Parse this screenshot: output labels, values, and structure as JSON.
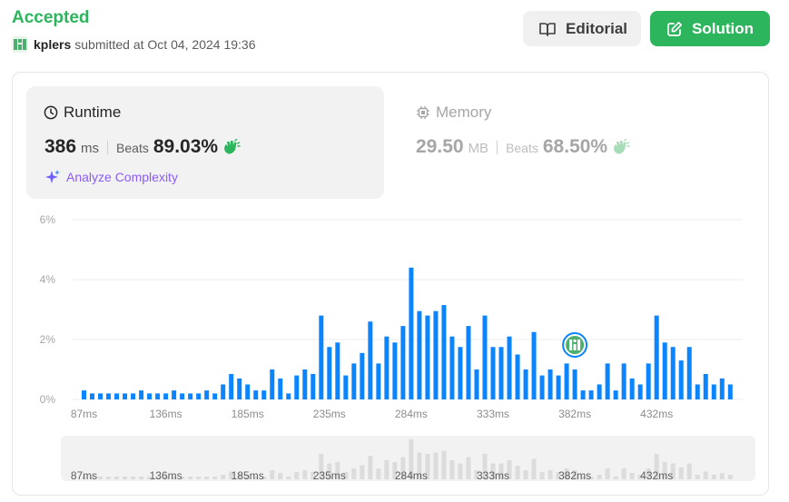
{
  "header": {
    "status": "Accepted",
    "username": "kplers",
    "submitted_text": "submitted at Oct 04, 2024 19:36",
    "editorial_label": "Editorial",
    "solution_label": "Solution"
  },
  "runtime": {
    "title": "Runtime",
    "value": "386",
    "unit": "ms",
    "beats_label": "Beats",
    "beats_pct": "89.03%",
    "analyze_label": "Analyze Complexity"
  },
  "memory": {
    "title": "Memory",
    "value": "29.50",
    "unit": "MB",
    "beats_label": "Beats",
    "beats_pct": "68.50%"
  },
  "colors": {
    "accent_green": "#2db55d",
    "bar_blue": "#0a84ff",
    "nav_bar_gray": "#dcdcdc",
    "analyze_purple": "#8b5cf6"
  },
  "chart_data": {
    "type": "bar",
    "title": "",
    "xlabel": "",
    "ylabel": "",
    "ylim": [
      0,
      6
    ],
    "y_ticks": [
      "0%",
      "2%",
      "4%",
      "6%"
    ],
    "x_tick_labels": [
      "87ms",
      "136ms",
      "185ms",
      "235ms",
      "284ms",
      "333ms",
      "382ms",
      "432ms"
    ],
    "x_tick_bar_index": [
      0,
      10,
      20,
      30,
      40,
      50,
      60,
      70
    ],
    "values": [
      0.3,
      0.2,
      0.2,
      0.2,
      0.2,
      0.2,
      0.2,
      0.3,
      0.2,
      0.2,
      0.2,
      0.3,
      0.2,
      0.2,
      0.2,
      0.3,
      0.2,
      0.5,
      0.85,
      0.7,
      0.5,
      0.3,
      0.3,
      1.0,
      0.7,
      0.2,
      0.8,
      1.0,
      0.85,
      2.8,
      1.75,
      1.9,
      0.8,
      1.2,
      1.55,
      2.6,
      1.2,
      2.1,
      1.9,
      2.45,
      4.4,
      2.95,
      2.8,
      2.95,
      3.15,
      2.1,
      1.75,
      2.45,
      1.0,
      2.8,
      1.75,
      1.75,
      2.1,
      1.5,
      1.0,
      2.25,
      0.8,
      1.0,
      0.8,
      1.2,
      1.0,
      0.3,
      0.3,
      0.5,
      1.2,
      0.3,
      1.2,
      0.7,
      0.5,
      1.2,
      2.8,
      1.9,
      1.75,
      1.3,
      1.75,
      0.5,
      0.85,
      0.5,
      0.7,
      0.5
    ],
    "highlight_bar_index": 60,
    "highlight_label": "386 ms"
  }
}
